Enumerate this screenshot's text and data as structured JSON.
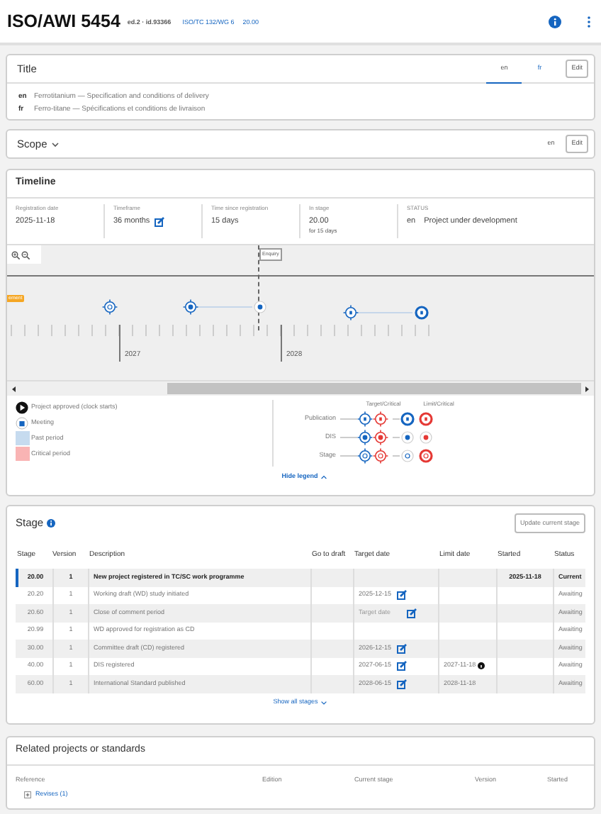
{
  "header": {
    "title": "ISO/AWI 5454",
    "edition": "ed.2 · id.93366",
    "committee": "ISO/TC 132/WG 6",
    "stage": "20.00"
  },
  "title_card": {
    "heading": "Title",
    "tabs": [
      {
        "label": "en",
        "selected": true
      },
      {
        "label": "fr",
        "selected": false
      }
    ],
    "edit": "Edit",
    "lines": [
      {
        "lang": "en",
        "text": "Ferrotitanium — Specification and conditions of delivery"
      },
      {
        "lang": "fr",
        "text": "Ferro-titane — Spécifications et conditions de livraison"
      }
    ]
  },
  "scope": {
    "heading": "Scope",
    "lang": "en",
    "edit": "Edit"
  },
  "timeline": {
    "heading": "Timeline",
    "facts": [
      {
        "label": "Registration date",
        "value": "2025-11-18",
        "editable": false
      },
      {
        "label": "Timeframe",
        "value": "36 months",
        "editable": true
      },
      {
        "label": "Time since registration",
        "value": "15 days",
        "editable": false
      },
      {
        "label": "In stage",
        "value": "20.00",
        "note": "for 15 days",
        "editable": false
      }
    ],
    "status": {
      "label": "STATUS",
      "lang": "en",
      "value": "Project under development"
    },
    "enquiry": "Enquiry",
    "tag": "ement",
    "years": [
      "2027",
      "2028"
    ],
    "legend_items": [
      {
        "kind": "approved",
        "label": "Project approved (clock starts)"
      },
      {
        "kind": "meeting",
        "label": "Meeting"
      },
      {
        "kind": "past",
        "label": "Past period"
      },
      {
        "kind": "critical",
        "label": "Critical period"
      }
    ],
    "legend_columns": [
      "Target/Critical",
      "Limit/Critical"
    ],
    "legend_rows": [
      {
        "kind": "publication",
        "label": "Publication"
      },
      {
        "kind": "dis",
        "label": "DIS"
      },
      {
        "kind": "stage",
        "label": "Stage"
      }
    ],
    "hide_legend": "Hide legend"
  },
  "stage": {
    "heading": "Stage",
    "update": "Update current stage",
    "columns": [
      "Stage",
      "Version",
      "Description",
      "Go to draft",
      "Target date",
      "Limit date",
      "Started",
      "Status"
    ],
    "rows": [
      {
        "stage": "20.00",
        "version": "1",
        "description": "New project registered in TC/SC work programme",
        "target_editable": false,
        "limit_info": false,
        "started": "2025-11-18",
        "status": "Current",
        "current": true
      },
      {
        "stage": "20.20",
        "version": "1",
        "description": "Working draft (WD) study initiated",
        "target": "2025-12-15",
        "target_editable": true,
        "limit_info": false,
        "status": "Awaiting",
        "current": false
      },
      {
        "stage": "20.60",
        "version": "1",
        "description": "Close of comment period",
        "placeholder": "Target date",
        "target_editable": true,
        "limit_info": false,
        "status": "Awaiting",
        "current": false
      },
      {
        "stage": "20.99",
        "version": "1",
        "description": "WD approved for registration as CD",
        "target_editable": false,
        "limit_info": false,
        "status": "Awaiting",
        "current": false
      },
      {
        "stage": "30.00",
        "version": "1",
        "description": "Committee draft (CD) registered",
        "target": "2026-12-15",
        "target_editable": true,
        "limit_info": false,
        "status": "Awaiting",
        "current": false
      },
      {
        "stage": "40.00",
        "version": "1",
        "description": "DIS registered",
        "target": "2027-06-15",
        "target_editable": true,
        "limit": "2027-11-18",
        "limit_info": true,
        "status": "Awaiting",
        "current": false
      },
      {
        "stage": "60.00",
        "version": "1",
        "description": "International Standard published",
        "target": "2028-06-15",
        "target_editable": true,
        "limit": "2028-11-18",
        "limit_info": false,
        "status": "Awaiting",
        "current": false
      }
    ],
    "show_all": "Show all stages"
  },
  "related": {
    "heading": "Related projects or standards",
    "columns": [
      "Reference",
      "Edition",
      "Current stage",
      "Version",
      "Started"
    ],
    "rows": [
      {
        "label": "Revises (1)",
        "expanded": false
      }
    ]
  }
}
